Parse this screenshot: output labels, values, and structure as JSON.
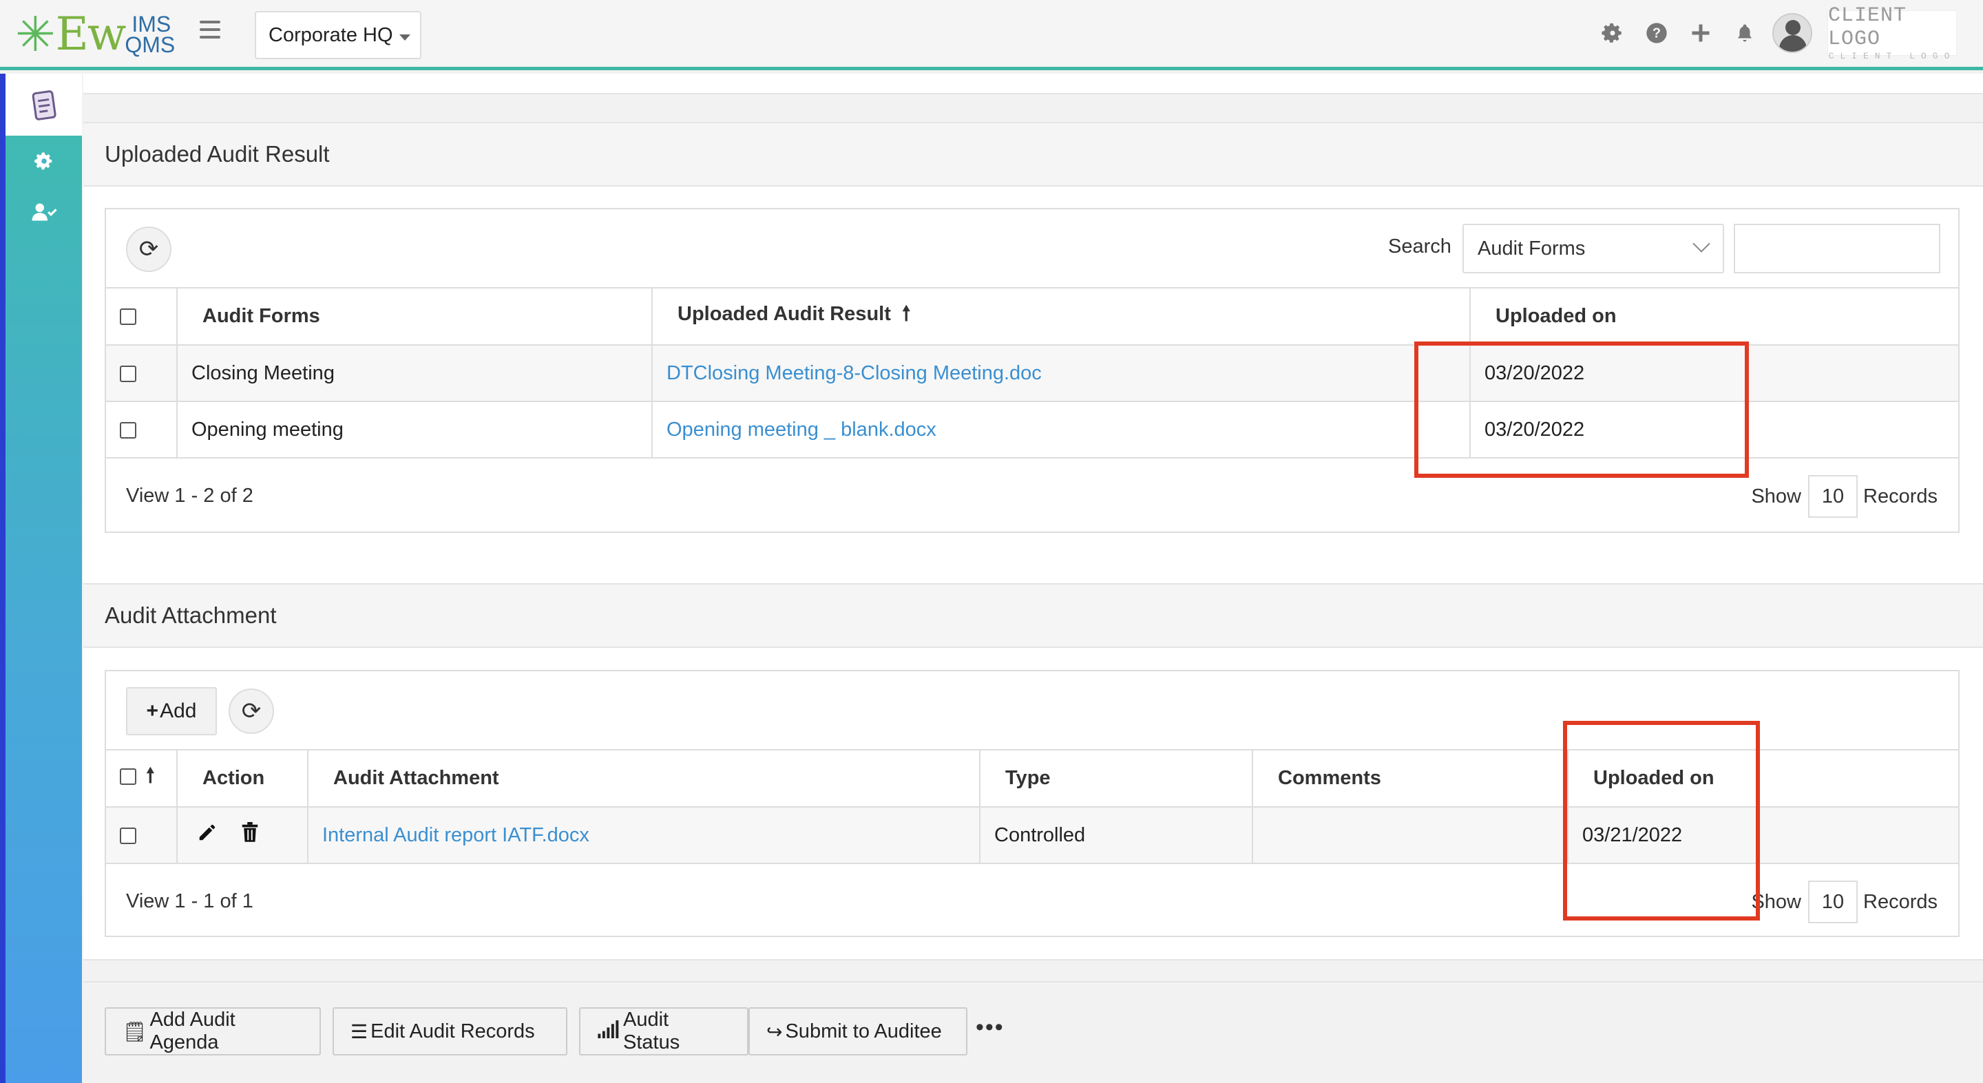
{
  "app": {
    "logo_main": "Ew",
    "logo_ims": "IMS",
    "logo_qms": "QMS",
    "site": "Corporate HQ",
    "client_logo_big": "CLIENT LOGO",
    "client_logo_small": "CLIENT LOGO"
  },
  "uploaded_results": {
    "title": "Uploaded Audit Result",
    "search_label": "Search",
    "search_field": "Audit Forms",
    "search_value": "",
    "columns": [
      "Audit Forms",
      "Uploaded Audit Result",
      "Uploaded on"
    ],
    "sort_indicator": "🠕",
    "rows": [
      {
        "form": "Closing Meeting",
        "file": "DTClosing Meeting-8-Closing Meeting.doc",
        "date": "03/20/2022"
      },
      {
        "form": "Opening meeting",
        "file": "Opening meeting _ blank.docx",
        "date": "03/20/2022"
      }
    ],
    "view_text": "View 1 - 2 of 2",
    "show_label": "Show",
    "page_size": "10",
    "records_label": "Records"
  },
  "attachments": {
    "title": "Audit Attachment",
    "add_label": "Add",
    "columns": [
      "Action",
      "Audit Attachment",
      "Type",
      "Comments",
      "Uploaded on"
    ],
    "rows": [
      {
        "file": "Internal Audit report IATF.docx",
        "type": "Controlled",
        "comments": "",
        "date": "03/21/2022"
      }
    ],
    "view_text": "View 1 - 1 of 1",
    "show_label": "Show",
    "page_size": "10",
    "records_label": "Records"
  },
  "actions": {
    "add_agenda": "Add Audit Agenda",
    "edit_records": "Edit Audit Records",
    "audit_status": "Audit Status",
    "submit": "Submit to Auditee",
    "more": "•••"
  },
  "colors": {
    "accent": "#3fb8a5",
    "link": "#3a8fd0",
    "highlight": "#e03a22"
  }
}
